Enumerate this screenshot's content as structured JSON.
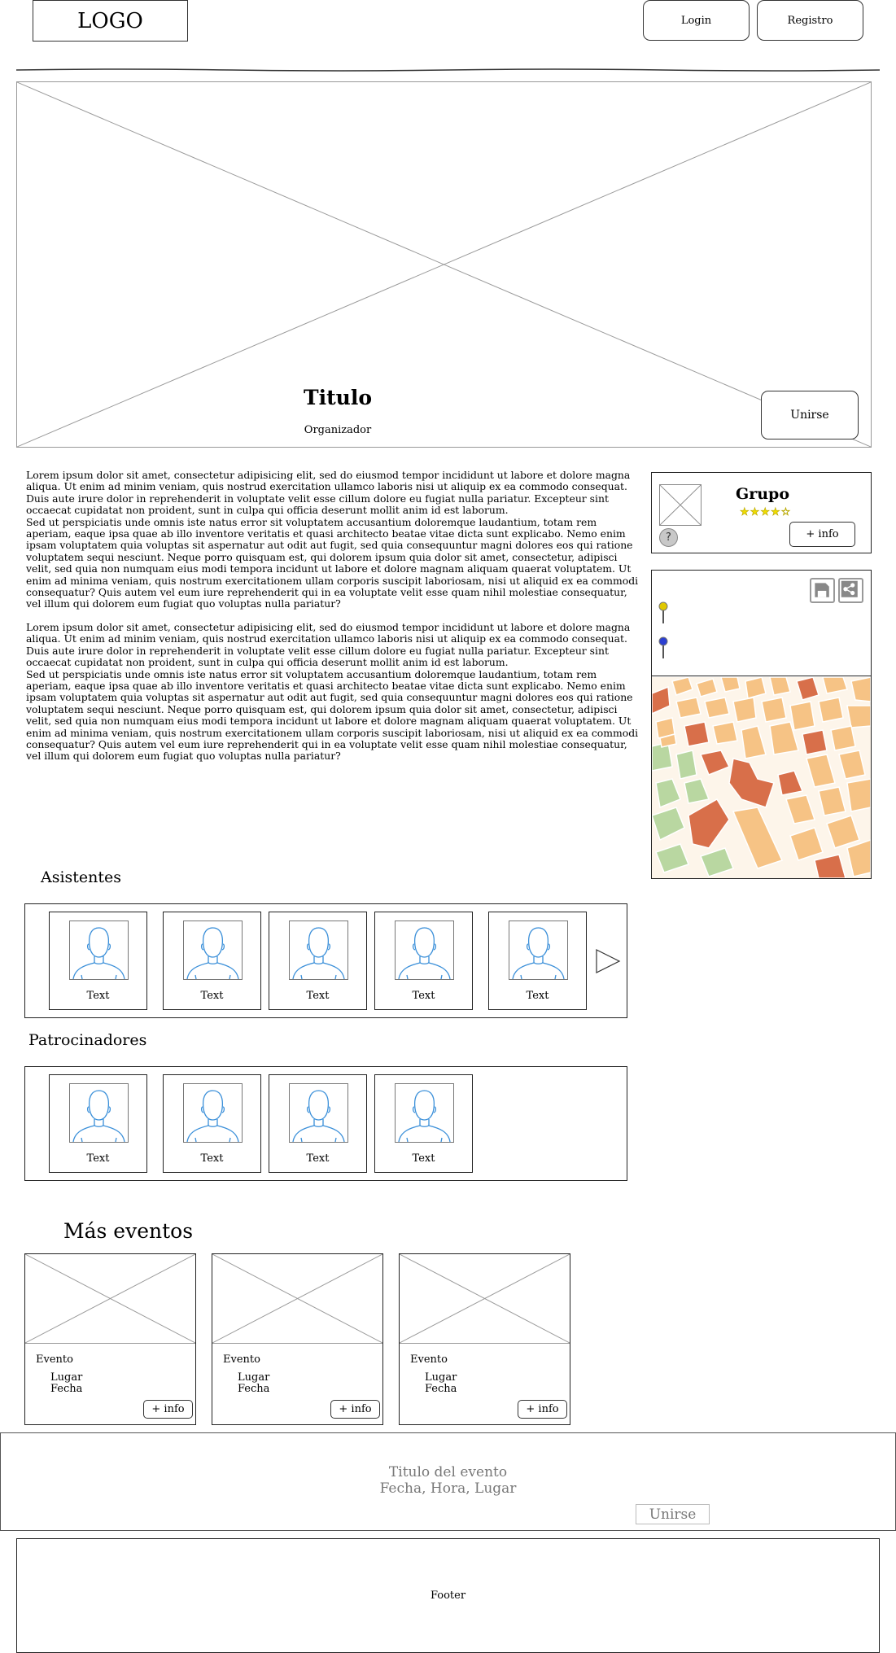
{
  "header": {
    "logo_text": "LOGO",
    "login_label": "Login",
    "register_label": "Registro"
  },
  "hero": {
    "title": "Titulo",
    "organizer": "Organizador",
    "join_label": "Unirse"
  },
  "description": {
    "paragraph1": "Lorem ipsum dolor sit amet, consectetur adipisicing elit, sed do eiusmod tempor incididunt ut labore et dolore magna aliqua. Ut enim ad minim veniam, quis nostrud exercitation ullamco laboris nisi ut aliquip ex ea commodo consequat. Duis aute irure dolor in reprehenderit in voluptate velit esse cillum dolore eu fugiat nulla pariatur. Excepteur sint occaecat cupidatat non proident, sunt in culpa qui officia deserunt mollit anim id est laborum.",
    "paragraph2": "Sed ut perspiciatis unde omnis iste natus error sit voluptatem accusantium doloremque laudantium, totam rem aperiam, eaque ipsa quae ab illo inventore veritatis et quasi architecto beatae vitae dicta sunt explicabo. Nemo enim ipsam voluptatem quia voluptas sit aspernatur aut odit aut fugit, sed quia consequuntur magni dolores eos qui ratione voluptatem sequi nesciunt. Neque porro quisquam est, qui dolorem ipsum quia dolor sit amet, consectetur, adipisci velit, sed quia non numquam eius modi tempora incidunt ut labore et dolore magnam aliquam quaerat voluptatem. Ut enim ad minima veniam, quis nostrum exercitationem ullam corporis suscipit laboriosam, nisi ut aliquid ex ea commodi consequatur? Quis autem vel eum iure reprehenderit qui in ea voluptate velit esse quam nihil molestiae consequatur, vel illum qui dolorem eum fugiat quo voluptas nulla pariatur?",
    "paragraph3": "Lorem ipsum dolor sit amet, consectetur adipisicing elit, sed do eiusmod tempor incididunt ut labore et dolore magna aliqua. Ut enim ad minim veniam, quis nostrud exercitation ullamco laboris nisi ut aliquip ex ea commodo consequat. Duis aute irure dolor in reprehenderit in voluptate velit esse cillum dolore eu fugiat nulla pariatur. Excepteur sint occaecat cupidatat non proident, sunt in culpa qui officia deserunt mollit anim id est laborum.",
    "paragraph4": "Sed ut perspiciatis unde omnis iste natus error sit voluptatem accusantium doloremque laudantium, totam rem aperiam, eaque ipsa quae ab illo inventore veritatis et quasi architecto beatae vitae dicta sunt explicabo. Nemo enim ipsam voluptatem quia voluptas sit aspernatur aut odit aut fugit, sed quia consequuntur magni dolores eos qui ratione voluptatem sequi nesciunt. Neque porro quisquam est, qui dolorem ipsum quia dolor sit amet, consectetur, adipisci velit, sed quia non numquam eius modi tempora incidunt ut labore et dolore magnam aliquam quaerat voluptatem. Ut enim ad minima veniam, quis nostrum exercitationem ullam corporis suscipit laboriosam, nisi ut aliquid ex ea commodi consequatur? Quis autem vel eum iure reprehenderit qui in ea voluptate velit esse quam nihil molestiae consequatur, vel illum qui dolorem eum fugiat quo voluptas nulla pariatur?"
  },
  "group": {
    "name": "Grupo",
    "rating": 4,
    "rating_max": 5,
    "help_icon_text": "?",
    "info_label": "+ info"
  },
  "map": {
    "pin_colors": [
      "#e0c800",
      "#2b3fd1"
    ],
    "icons": [
      "save-icon",
      "share-icon"
    ]
  },
  "attendees": {
    "title": "Asistentes",
    "items": [
      {
        "label": "Text"
      },
      {
        "label": "Text"
      },
      {
        "label": "Text"
      },
      {
        "label": "Text"
      },
      {
        "label": "Text"
      }
    ]
  },
  "sponsors": {
    "title": "Patrocinadores",
    "items": [
      {
        "label": "Text"
      },
      {
        "label": "Text"
      },
      {
        "label": "Text"
      },
      {
        "label": "Text"
      }
    ]
  },
  "more_events": {
    "title": "Más eventos",
    "items": [
      {
        "title": "Evento",
        "place": "Lugar",
        "date": "Fecha",
        "info_label": "+ info"
      },
      {
        "title": "Evento",
        "place": "Lugar",
        "date": "Fecha",
        "info_label": "+ info"
      },
      {
        "title": "Evento",
        "place": "Lugar",
        "date": "Fecha",
        "info_label": "+ info"
      }
    ]
  },
  "sticky_bar": {
    "line1": "Titulo del evento",
    "line2": "Fecha, Hora, Lugar",
    "join_label": "Unirse"
  },
  "footer": {
    "label": "Footer"
  }
}
